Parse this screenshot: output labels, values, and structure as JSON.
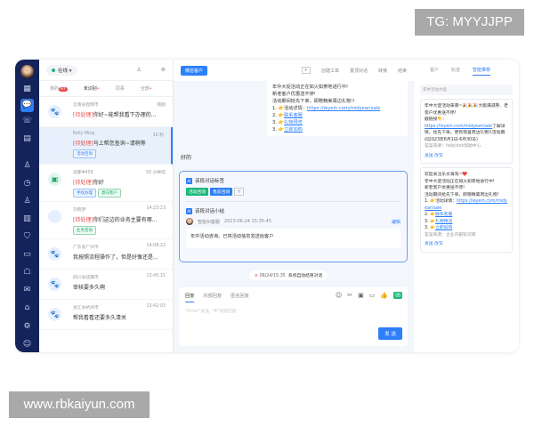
{
  "watermarks": {
    "top": "TG: MYYJJPP",
    "bottom": "www.rbkaiyun.com"
  },
  "sidebar": {
    "icons": [
      "avatar",
      "grid-icon",
      "chat-icon",
      "phone-icon",
      "clipboard-icon",
      "user-icon",
      "clock-user-icon",
      "contacts-icon",
      "chart-icon",
      "shield-icon",
      "monitor-icon",
      "robot-icon",
      "mail-icon",
      "gift-icon",
      "settings-icon",
      "feedback-icon"
    ]
  },
  "list": {
    "status": "在线",
    "tabs": [
      {
        "label": "我的",
        "badge": "97"
      },
      {
        "label": "未识别"
      },
      {
        "label": "同事"
      },
      {
        "label": "全部"
      }
    ],
    "items": [
      {
        "name": "云南省昆明市",
        "time": "刚刚",
        "flag": "[待处理]",
        "msg": "你好~能帮我看下办理的...",
        "tags": []
      },
      {
        "name": "Kelly Ming",
        "time": "10 秒",
        "flag": "[待处理]",
        "msg": "马上帮您查询~请稍等",
        "tags": [
          "活动咨询"
        ]
      },
      {
        "name": "成都#456",
        "time": "50 分钟前",
        "flag": "[待处理]",
        "msg": "你好",
        "tags": [
          "手续办理",
          "意向客户"
        ]
      },
      {
        "name": "刘晓梦",
        "time": "14:23:23",
        "flag": "[待处理]",
        "msg": "你们这边的业务主要有哪...",
        "tags": [
          "业务咨询"
        ]
      },
      {
        "name": "广东省广州市",
        "time": "14:08:22",
        "flag": "",
        "msg": "我按照流程操作了，但是好像还是...",
        "tags": []
      },
      {
        "name": "四川省成都市",
        "time": "13:45:15",
        "flag": "",
        "msg": "审核要多久啊",
        "tags": []
      },
      {
        "name": "浙江省杭州市",
        "time": "13:42:03",
        "flag": "",
        "msg": "帮我看看还要多久清关",
        "tags": []
      }
    ]
  },
  "chat": {
    "badge": "微信客户",
    "actions": [
      "创建工单",
      "置顶对话",
      "转接",
      "结束"
    ],
    "bubble": {
      "lines": [
        "年中大促活动正在如火如荼地进行中!",
        "新老客户优惠送不停!",
        "活动期间抢先下单，即赠精美周边礼物!!"
      ],
      "link1_label": "1. 👉活动详情：",
      "link1": "https://ieyein.com/midyear/sale",
      "l2": "2. 👉",
      "link2": "联系客服",
      "l3": "3. 👉",
      "link3": "礼物预览",
      "l4": "3. 👉",
      "link4": "立即加购"
    },
    "reply": "好的",
    "ai": {
      "tags_title": "该段对话标签",
      "tags": [
        "活动咨询",
        "售前咨询"
      ],
      "add": "+",
      "summary_title": "该段对话小结",
      "author": "智能AI客服",
      "datetime": "2023-06-24  15:35:45",
      "edit": "编辑",
      "summary": "年中活动咨询。已将活动信息发送给客户"
    },
    "system": {
      "time": "06/24/15:35",
      "text": "系统自动结束对话"
    },
    "input": {
      "tabs": [
        "回复",
        "内部回复",
        "匿名回复"
      ],
      "placeholder": "\"Enter\"发送, \"#\"快速回复",
      "send": "发 送"
    }
  },
  "right": {
    "tabs": [
      "客户",
      "轨迹",
      "智能推荐"
    ],
    "search_placeholder": "年中活动大促",
    "cards": [
      {
        "text": "年中大促活动来袭~🎉🎉🎉大额满减券、老客户优惠送不停!",
        "sub": "戳链接👇:",
        "link": "https://ieyein.com/midyear/sale",
        "after": "了解详情，抢先下单，更有惊喜周边礼物!(活动期间2023年6月1日-6月30日)",
        "src": "答案来源：helplook帮助中心",
        "btns": [
          "发送",
          "改写"
        ]
      },
      {
        "text": "欢迎关注乐文海淘~❤️",
        "lines": [
          "年中大促活动正在如火如荼地进行中!",
          "新老客户优惠送不停!",
          "活动期间抢先下单，即赠精美周边礼物!"
        ],
        "l1": "1. 👉活动详情：",
        "link": "https://ieyein.com/midyear/sale",
        "l2": "2. 👉",
        "link2": "联系客服",
        "l3": "3. 👉",
        "link3": "礼物预览",
        "l4": "3. 👉",
        "link4": "立即加购",
        "src": "答案来源：企业内部知识库",
        "btns": [
          "发送",
          "改写"
        ]
      }
    ]
  },
  "colors": {
    "accent": "#2d7ff9",
    "sidebar": "#14235a",
    "pending": "#e84a4a",
    "green": "#1db87a"
  }
}
